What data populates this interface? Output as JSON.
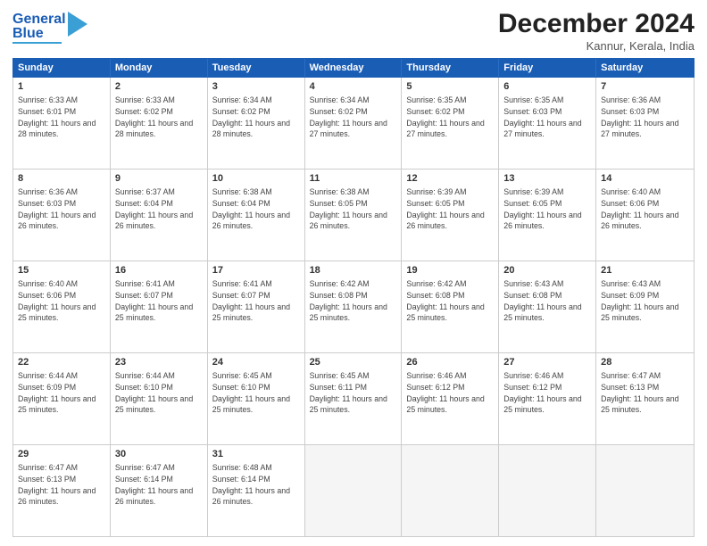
{
  "header": {
    "logo_line1": "General",
    "logo_line2": "Blue",
    "title": "December 2024",
    "subtitle": "Kannur, Kerala, India"
  },
  "days": [
    "Sunday",
    "Monday",
    "Tuesday",
    "Wednesday",
    "Thursday",
    "Friday",
    "Saturday"
  ],
  "weeks": [
    [
      {
        "day": 1,
        "sunrise": "6:33 AM",
        "sunset": "6:01 PM",
        "daylight": "11 hours and 28 minutes."
      },
      {
        "day": 2,
        "sunrise": "6:33 AM",
        "sunset": "6:02 PM",
        "daylight": "11 hours and 28 minutes."
      },
      {
        "day": 3,
        "sunrise": "6:34 AM",
        "sunset": "6:02 PM",
        "daylight": "11 hours and 28 minutes."
      },
      {
        "day": 4,
        "sunrise": "6:34 AM",
        "sunset": "6:02 PM",
        "daylight": "11 hours and 27 minutes."
      },
      {
        "day": 5,
        "sunrise": "6:35 AM",
        "sunset": "6:02 PM",
        "daylight": "11 hours and 27 minutes."
      },
      {
        "day": 6,
        "sunrise": "6:35 AM",
        "sunset": "6:03 PM",
        "daylight": "11 hours and 27 minutes."
      },
      {
        "day": 7,
        "sunrise": "6:36 AM",
        "sunset": "6:03 PM",
        "daylight": "11 hours and 27 minutes."
      }
    ],
    [
      {
        "day": 8,
        "sunrise": "6:36 AM",
        "sunset": "6:03 PM",
        "daylight": "11 hours and 26 minutes."
      },
      {
        "day": 9,
        "sunrise": "6:37 AM",
        "sunset": "6:04 PM",
        "daylight": "11 hours and 26 minutes."
      },
      {
        "day": 10,
        "sunrise": "6:38 AM",
        "sunset": "6:04 PM",
        "daylight": "11 hours and 26 minutes."
      },
      {
        "day": 11,
        "sunrise": "6:38 AM",
        "sunset": "6:05 PM",
        "daylight": "11 hours and 26 minutes."
      },
      {
        "day": 12,
        "sunrise": "6:39 AM",
        "sunset": "6:05 PM",
        "daylight": "11 hours and 26 minutes."
      },
      {
        "day": 13,
        "sunrise": "6:39 AM",
        "sunset": "6:05 PM",
        "daylight": "11 hours and 26 minutes."
      },
      {
        "day": 14,
        "sunrise": "6:40 AM",
        "sunset": "6:06 PM",
        "daylight": "11 hours and 26 minutes."
      }
    ],
    [
      {
        "day": 15,
        "sunrise": "6:40 AM",
        "sunset": "6:06 PM",
        "daylight": "11 hours and 25 minutes."
      },
      {
        "day": 16,
        "sunrise": "6:41 AM",
        "sunset": "6:07 PM",
        "daylight": "11 hours and 25 minutes."
      },
      {
        "day": 17,
        "sunrise": "6:41 AM",
        "sunset": "6:07 PM",
        "daylight": "11 hours and 25 minutes."
      },
      {
        "day": 18,
        "sunrise": "6:42 AM",
        "sunset": "6:08 PM",
        "daylight": "11 hours and 25 minutes."
      },
      {
        "day": 19,
        "sunrise": "6:42 AM",
        "sunset": "6:08 PM",
        "daylight": "11 hours and 25 minutes."
      },
      {
        "day": 20,
        "sunrise": "6:43 AM",
        "sunset": "6:08 PM",
        "daylight": "11 hours and 25 minutes."
      },
      {
        "day": 21,
        "sunrise": "6:43 AM",
        "sunset": "6:09 PM",
        "daylight": "11 hours and 25 minutes."
      }
    ],
    [
      {
        "day": 22,
        "sunrise": "6:44 AM",
        "sunset": "6:09 PM",
        "daylight": "11 hours and 25 minutes."
      },
      {
        "day": 23,
        "sunrise": "6:44 AM",
        "sunset": "6:10 PM",
        "daylight": "11 hours and 25 minutes."
      },
      {
        "day": 24,
        "sunrise": "6:45 AM",
        "sunset": "6:10 PM",
        "daylight": "11 hours and 25 minutes."
      },
      {
        "day": 25,
        "sunrise": "6:45 AM",
        "sunset": "6:11 PM",
        "daylight": "11 hours and 25 minutes."
      },
      {
        "day": 26,
        "sunrise": "6:46 AM",
        "sunset": "6:12 PM",
        "daylight": "11 hours and 25 minutes."
      },
      {
        "day": 27,
        "sunrise": "6:46 AM",
        "sunset": "6:12 PM",
        "daylight": "11 hours and 25 minutes."
      },
      {
        "day": 28,
        "sunrise": "6:47 AM",
        "sunset": "6:13 PM",
        "daylight": "11 hours and 25 minutes."
      }
    ],
    [
      {
        "day": 29,
        "sunrise": "6:47 AM",
        "sunset": "6:13 PM",
        "daylight": "11 hours and 26 minutes."
      },
      {
        "day": 30,
        "sunrise": "6:47 AM",
        "sunset": "6:14 PM",
        "daylight": "11 hours and 26 minutes."
      },
      {
        "day": 31,
        "sunrise": "6:48 AM",
        "sunset": "6:14 PM",
        "daylight": "11 hours and 26 minutes."
      },
      null,
      null,
      null,
      null
    ]
  ]
}
